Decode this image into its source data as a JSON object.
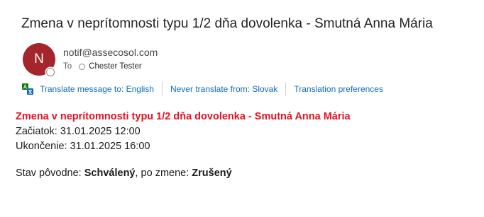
{
  "email": {
    "subject": "Zmena v neprítomnosti typu 1/2 dňa dovolenka  - Smutná Anna Mária",
    "avatar_initial": "N",
    "sender": "notif@assecosol.com",
    "to_label": "To",
    "recipient": "Chester Tester"
  },
  "translation_bar": {
    "translate_icon": "translate-icon",
    "translate_link": "Translate message to: English",
    "never_translate_link": "Never translate from: Slovak",
    "preferences_link": "Translation preferences"
  },
  "body": {
    "headline": "Zmena v neprítomnosti typu 1/2 dňa dovolenka - Smutná Anna Mária",
    "start": "Začiatok: 31.01.2025 12:00",
    "end": "Ukončenie: 31.01.2025 16:00",
    "status_prefix": "Stav pôvodne: ",
    "status_original": "Schválený",
    "status_middle": ", po zmene: ",
    "status_new": "Zrušený"
  },
  "colors": {
    "avatar_bg": "#a4262c",
    "link": "#0f6cbd",
    "headline": "#e81123"
  }
}
